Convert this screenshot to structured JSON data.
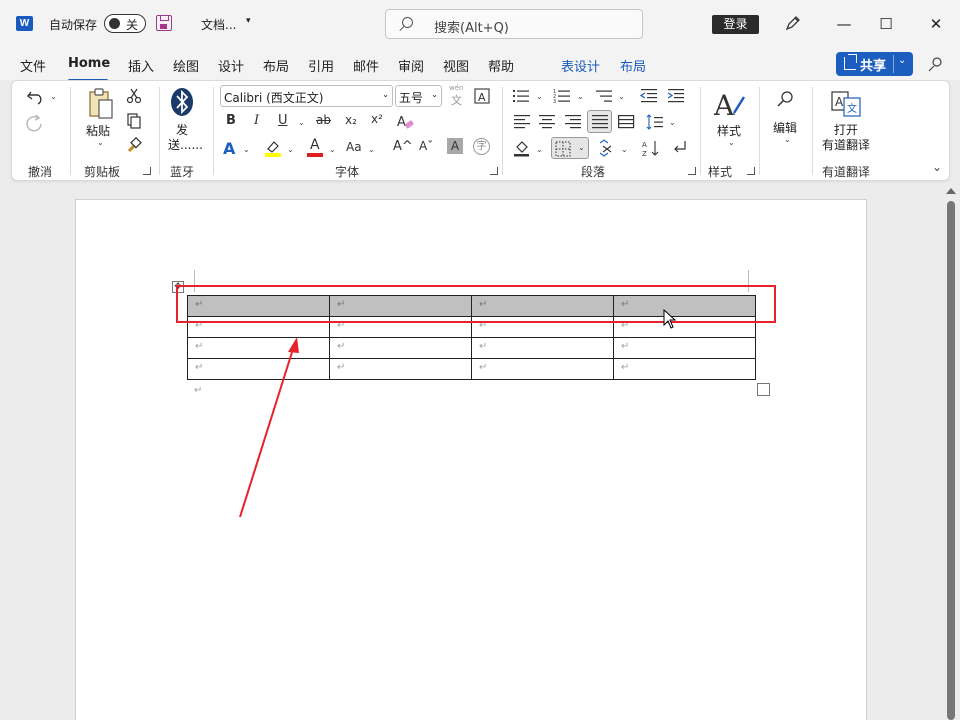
{
  "titlebar": {
    "app_logo": "W",
    "autosave_label": "自动保存",
    "autosave_state": "关",
    "doc_title": "文档...",
    "doc_title_caret": "▾",
    "search_placeholder": "搜索(Alt+Q)",
    "login_label": "登录",
    "minimize": "—",
    "maximize": "☐",
    "close": "✕"
  },
  "tabs": [
    {
      "label": "文件"
    },
    {
      "label": "Home"
    },
    {
      "label": "插入"
    },
    {
      "label": "绘图"
    },
    {
      "label": "设计"
    },
    {
      "label": "布局"
    },
    {
      "label": "引用"
    },
    {
      "label": "邮件"
    },
    {
      "label": "审阅"
    },
    {
      "label": "视图"
    },
    {
      "label": "帮助"
    },
    {
      "label": "表设计"
    },
    {
      "label": "布局"
    }
  ],
  "share": {
    "label": "共享",
    "caret": "⌄"
  },
  "ribbon": {
    "groups": {
      "undo": "撤消",
      "clipboard": "剪贴板",
      "bluetooth": "蓝牙",
      "font": "字体",
      "paragraph": "段落",
      "styles": "样式",
      "youdao": "有道翻译"
    },
    "paste_label": "粘贴",
    "send_label_1": "发",
    "send_label_2": "送......",
    "font_name": "Calibri (西文正文)",
    "font_size": "五号",
    "wen_top": "wén",
    "wen_char": "文",
    "bold": "B",
    "italic": "I",
    "underline": "U",
    "strike": "ab",
    "subscript": "x₂",
    "superscript": "x²",
    "text_effect": "A",
    "font_color_char": "A",
    "case_label": "Aa",
    "grow_font": "A^",
    "shrink_font": "Aˇ",
    "char_shade": "A",
    "enclose": "字",
    "styles_label": "样式",
    "edit_label": "编辑",
    "youdao_open_1": "打开",
    "youdao_open_2": "有道翻译"
  },
  "document": {
    "table_rows": [
      [
        "↵",
        "↵",
        "↵",
        "↵"
      ],
      [
        "↵",
        "↵",
        "↵",
        "↵"
      ],
      [
        "↵",
        "↵",
        "↵",
        "↵"
      ],
      [
        "↵",
        "↵",
        "↵",
        "↵"
      ]
    ],
    "paragraph_mark": "↵",
    "move_handle": "✥"
  },
  "colors": {
    "accent": "#185abd",
    "highlight_box": "#e8222a",
    "arrow": "#e8222a",
    "shaded_row": "#c0c0c0"
  }
}
